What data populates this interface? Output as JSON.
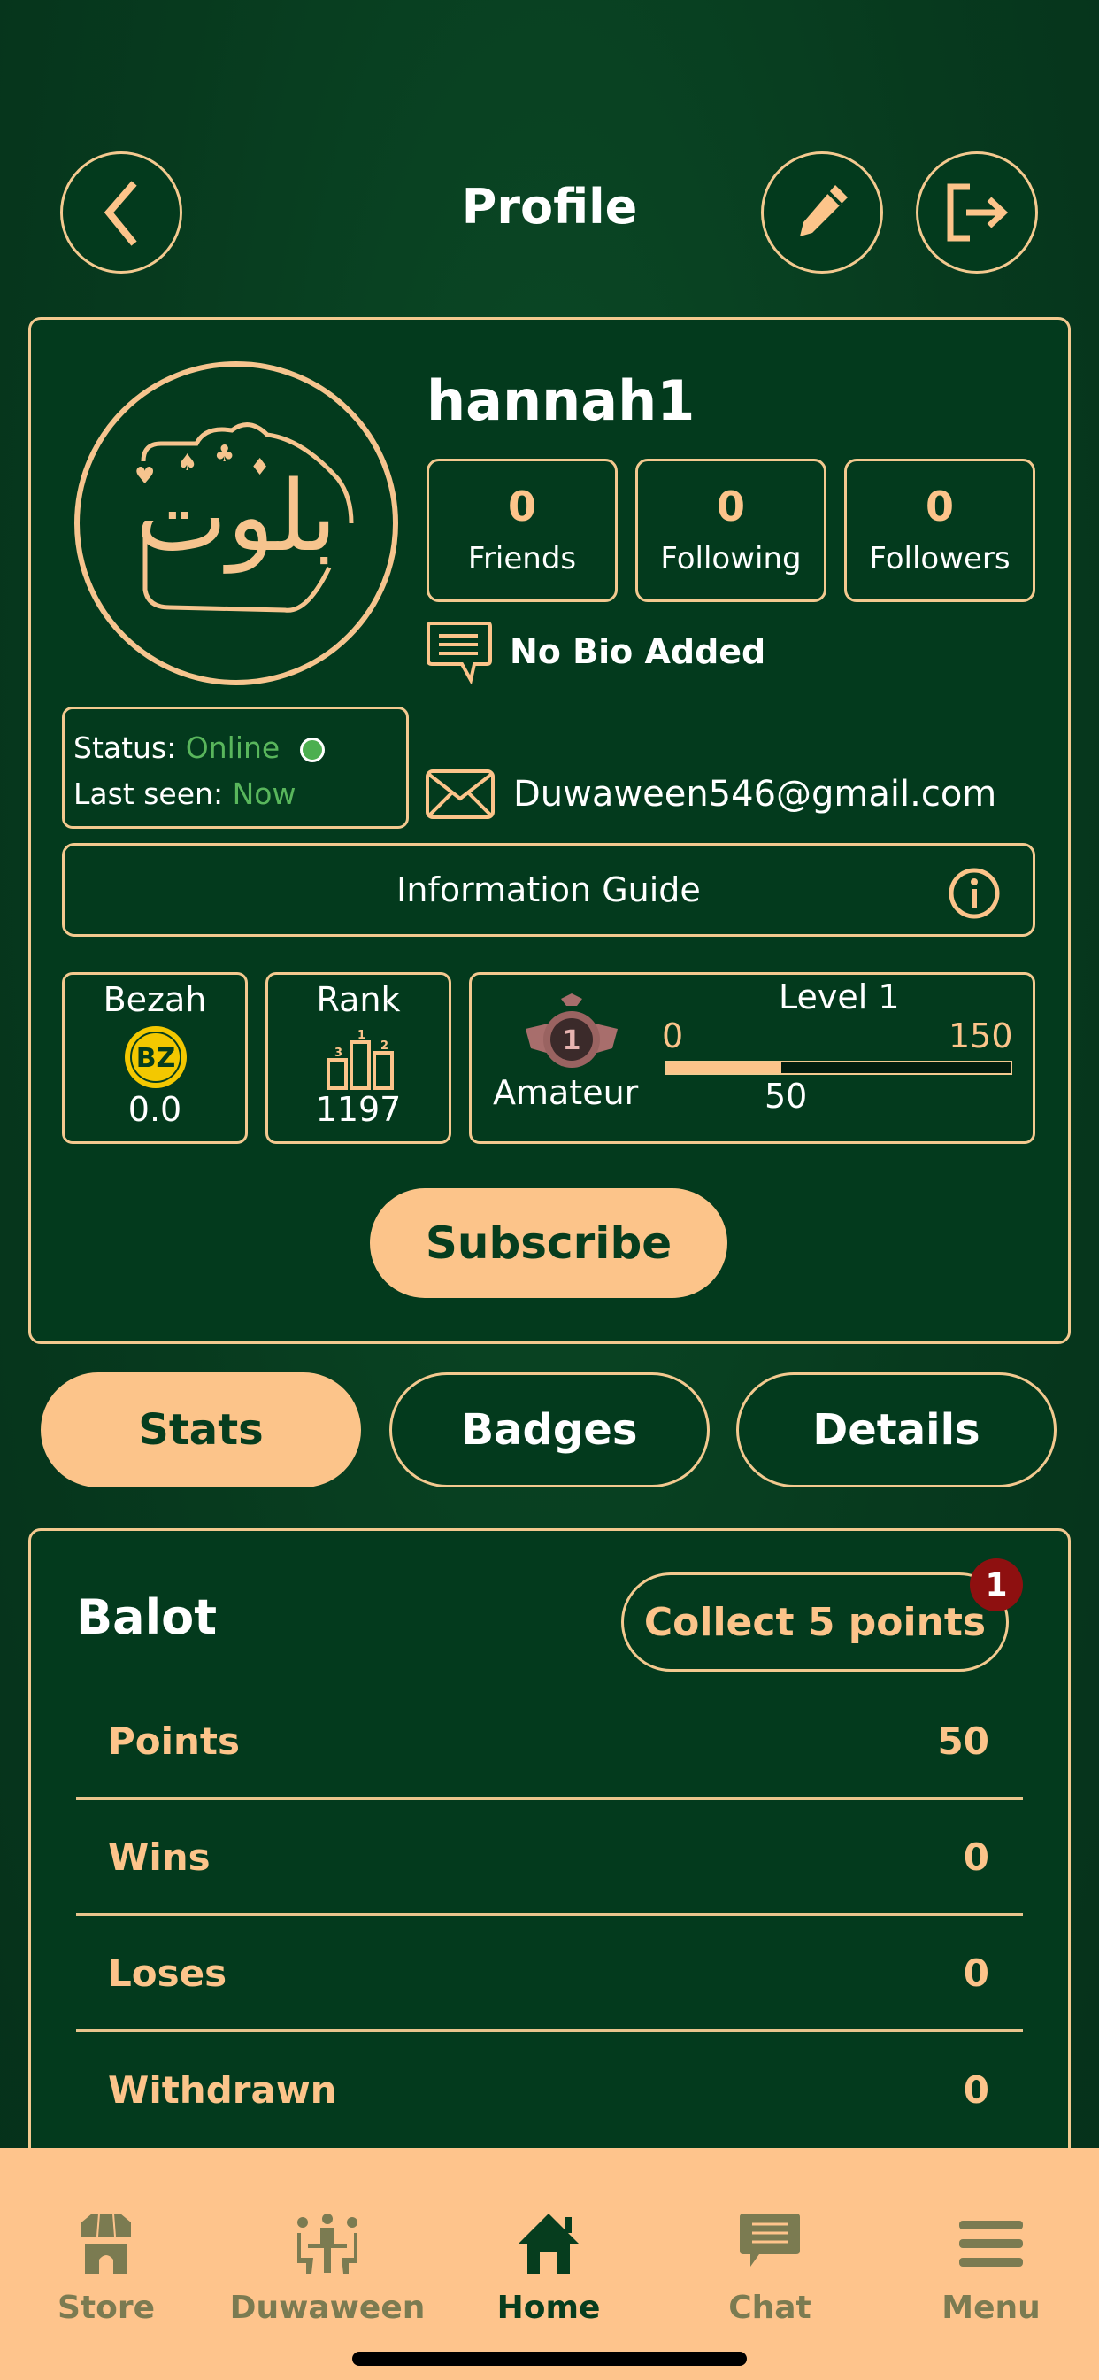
{
  "header": {
    "title": "Profile",
    "back_icon": "chevron-left-icon",
    "edit_icon": "pencil-icon",
    "logout_icon": "logout-icon"
  },
  "profile": {
    "avatar_text": "بلوت",
    "username": "hannah1",
    "stats": [
      {
        "value": "0",
        "label": "Friends"
      },
      {
        "value": "0",
        "label": "Following"
      },
      {
        "value": "0",
        "label": "Followers"
      }
    ],
    "bio": "No Bio Added",
    "status_label": "Status:",
    "status_value": "Online",
    "last_seen_label": "Last seen:",
    "last_seen_value": "Now",
    "email": "Duwaween546@gmail.com",
    "info_guide_label": "Information Guide",
    "bezah": {
      "title": "Bezah",
      "value": "0.0",
      "coin_text": "BZ"
    },
    "rank": {
      "title": "Rank",
      "value": "1197",
      "podium": [
        "3",
        "1",
        "2"
      ]
    },
    "level": {
      "title": "Level 1",
      "tier": "Amateur",
      "badge_number": "1",
      "min": "0",
      "max": "150",
      "current": "50",
      "progress_fraction": 0.333
    },
    "subscribe_label": "Subscribe"
  },
  "tabs": [
    {
      "label": "Stats",
      "active": true
    },
    {
      "label": "Badges",
      "active": false
    },
    {
      "label": "Details",
      "active": false
    }
  ],
  "game_stats": {
    "title": "Balot",
    "collect_label": "Collect 5 points",
    "collect_badge": "1",
    "rows": [
      {
        "label": "Points",
        "value": "50"
      },
      {
        "label": "Wins",
        "value": "0"
      },
      {
        "label": "Loses",
        "value": "0"
      },
      {
        "label": "Withdrawn",
        "value": "0"
      }
    ]
  },
  "bottom_nav": [
    {
      "label": "Store",
      "icon": "store-icon",
      "active": false
    },
    {
      "label": "Duwaween",
      "icon": "people-table-icon",
      "active": false
    },
    {
      "label": "Home",
      "icon": "home-icon",
      "active": true
    },
    {
      "label": "Chat",
      "icon": "chat-icon",
      "active": false
    },
    {
      "label": "Menu",
      "icon": "menu-icon",
      "active": false
    }
  ],
  "colors": {
    "background": "#073a1e",
    "accent_gold": "#fcc48a",
    "border_gold": "#f3c98f",
    "online_green": "#59b65c",
    "badge_red": "#8e1010",
    "nav_inactive": "#7b7b51"
  }
}
